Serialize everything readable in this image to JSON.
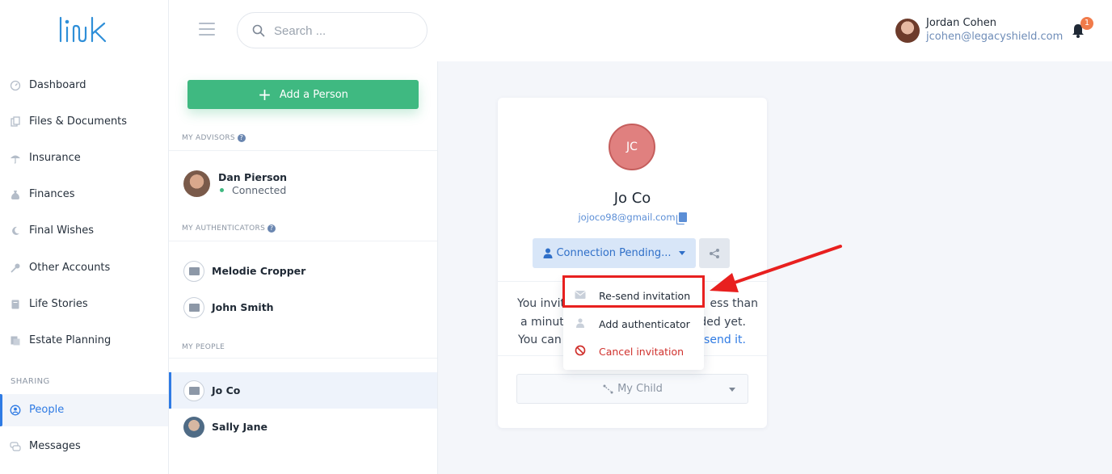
{
  "app": {
    "logo_text": "link"
  },
  "sidebar": {
    "items": [
      {
        "label": "Dashboard",
        "icon": "dashboard-icon"
      },
      {
        "label": "Files & Documents",
        "icon": "files-icon"
      },
      {
        "label": "Insurance",
        "icon": "umbrella-icon"
      },
      {
        "label": "Finances",
        "icon": "money-bag-icon"
      },
      {
        "label": "Final Wishes",
        "icon": "moon-icon"
      },
      {
        "label": "Other Accounts",
        "icon": "key-icon"
      },
      {
        "label": "Life Stories",
        "icon": "book-icon"
      },
      {
        "label": "Estate Planning",
        "icon": "document-icon"
      }
    ],
    "sharing_label": "SHARING",
    "sharing_items": [
      {
        "label": "People",
        "icon": "person-circle-icon",
        "active": true
      },
      {
        "label": "Messages",
        "icon": "chat-icon"
      }
    ]
  },
  "header": {
    "search_placeholder": "Search ...",
    "user_name": "Jordan Cohen",
    "user_email": "jcohen@legacyshield.com",
    "notification_count": "1"
  },
  "people_panel": {
    "add_button": "Add a Person",
    "advisors_title": "MY ADVISORS",
    "advisors": [
      {
        "name": "Dan Pierson",
        "status": "Connected"
      }
    ],
    "authenticators_title": "MY AUTHENTICATORS",
    "authenticators": [
      {
        "name": "Melodie Cropper"
      },
      {
        "name": "John Smith"
      }
    ],
    "people_title": "MY PEOPLE",
    "people": [
      {
        "name": "Jo Co",
        "active": true
      },
      {
        "name": "Sally Jane"
      }
    ]
  },
  "card": {
    "initials": "JC",
    "name": "Jo Co",
    "email": "jojoco98@gmail.com",
    "status_button": "Connection Pending...",
    "text_line1_left": "You invit",
    "text_line1_right": "ess than",
    "text_line2_left": "a minut",
    "text_line2_right": "ded yet.",
    "text_line3_left": "You can",
    "text_line3_right": "-send it.",
    "role": "My Child"
  },
  "dropdown": {
    "items": [
      {
        "label": "Re-send invitation",
        "icon": "envelope-icon"
      },
      {
        "label": "Add authenticator",
        "icon": "person-icon"
      },
      {
        "label": "Cancel invitation",
        "icon": "cancel-icon"
      }
    ]
  },
  "colors": {
    "accent": "#2f7be4",
    "add_button": "#3fb981",
    "cancel": "#d0312d",
    "highlight": "#e8201f",
    "avatar_jc": "#e0807f"
  }
}
